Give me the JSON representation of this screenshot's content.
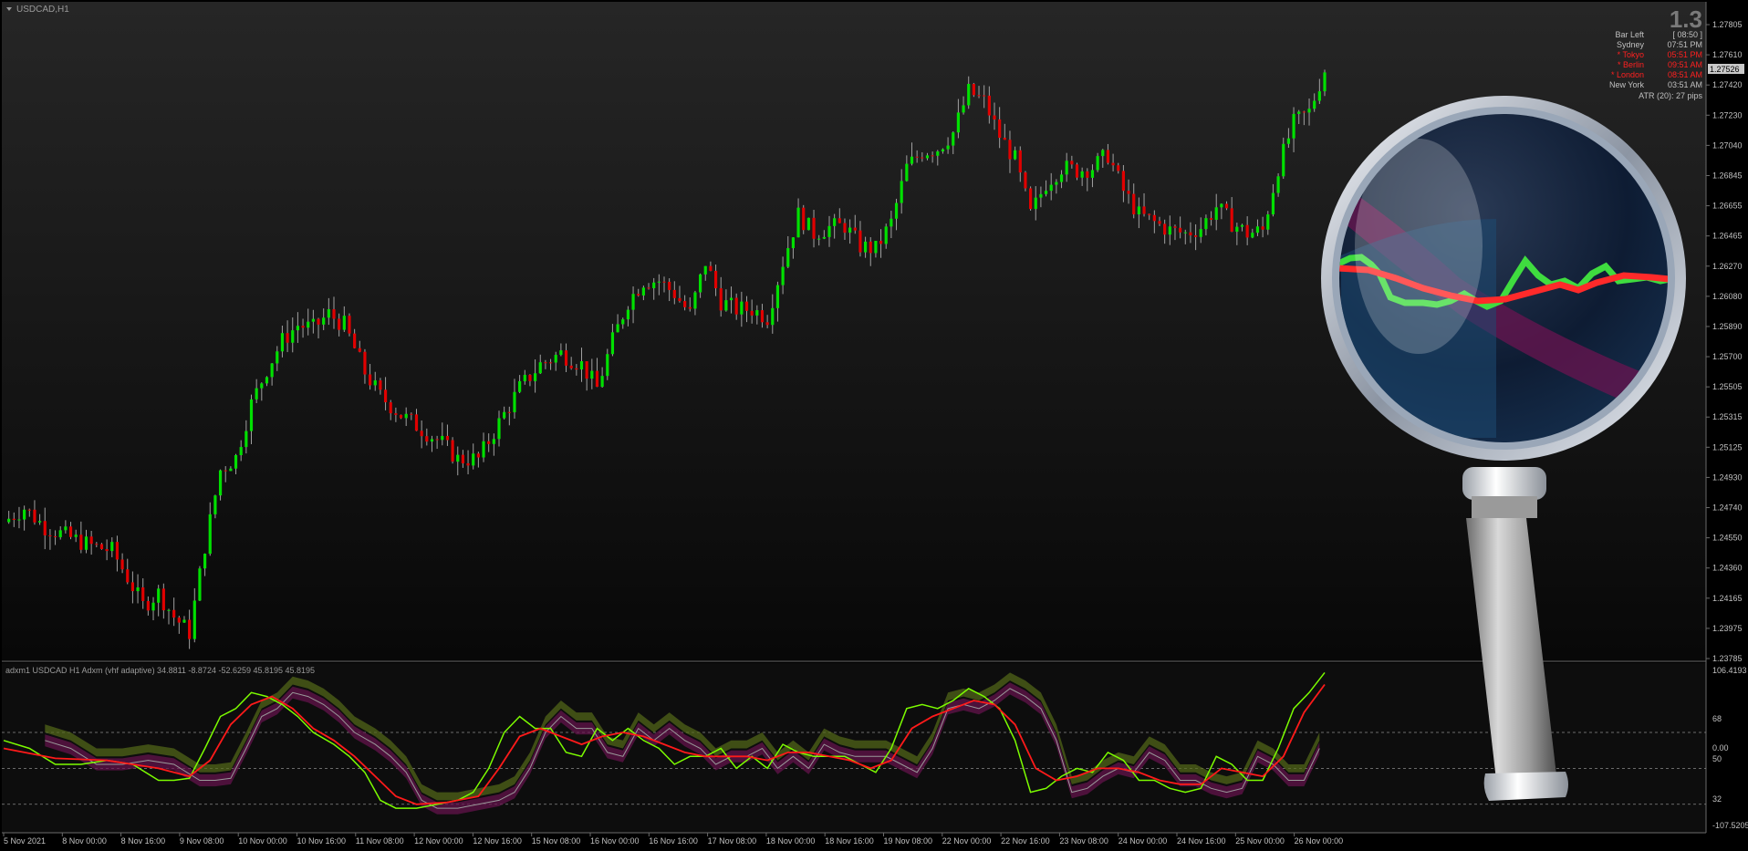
{
  "window": {
    "title": "USDCAD,H1",
    "menu_icon": "triangle-down-icon"
  },
  "info_panel": {
    "big_value": "1.3",
    "rows": [
      {
        "label": "Bar Left",
        "value": "[ 08:50 ]",
        "color": "#c0c0c0"
      },
      {
        "label": "Sydney",
        "value": "07:51 PM",
        "color": "#c0c0c0"
      },
      {
        "label": "* Tokyo",
        "value": "05:51 PM",
        "color": "#ff2020"
      },
      {
        "label": "* Berlin",
        "value": "09:51 AM",
        "color": "#ff2020"
      },
      {
        "label": "* London",
        "value": "08:51 AM",
        "color": "#ff2020"
      },
      {
        "label": "New York",
        "value": "03:51 AM",
        "color": "#c0c0c0"
      }
    ],
    "atr": "ATR (20): 27 pips"
  },
  "price_axis": {
    "ticks": [
      "1.27805",
      "1.27610",
      "1.27420",
      "1.27230",
      "1.27040",
      "1.26845",
      "1.26655",
      "1.26465",
      "1.26270",
      "1.26080",
      "1.25890",
      "1.25700",
      "1.25505",
      "1.25315",
      "1.25125",
      "1.24930",
      "1.24740",
      "1.24550",
      "1.24360",
      "1.24165",
      "1.23975",
      "1.23785"
    ],
    "current_price": "1.27526",
    "range": [
      1.23785,
      1.27805
    ]
  },
  "indicator": {
    "label": "adxm1 USDCAD H1 Adxm (vhf adaptive) 34.8811 -8.8724 -52.6259 45.8195 45.8195",
    "axis_ticks": [
      "106.4193",
      "68",
      "0.00",
      "50",
      "32",
      "-107.5205"
    ],
    "levels": [
      68,
      50,
      32
    ]
  },
  "time_axis": {
    "labels": [
      "5 Nov 2021",
      "8 Nov 00:00",
      "8 Nov 16:00",
      "9 Nov 08:00",
      "10 Nov 00:00",
      "10 Nov 16:00",
      "11 Nov 08:00",
      "12 Nov 00:00",
      "12 Nov 16:00",
      "15 Nov 08:00",
      "16 Nov 00:00",
      "16 Nov 16:00",
      "17 Nov 08:00",
      "18 Nov 00:00",
      "18 Nov 16:00",
      "19 Nov 08:00",
      "22 Nov 00:00",
      "22 Nov 16:00",
      "23 Nov 08:00",
      "24 Nov 00:00",
      "24 Nov 16:00",
      "25 Nov 00:00",
      "26 Nov 00:00"
    ]
  },
  "colors": {
    "bull": "#00e000",
    "bear": "#e00000",
    "background_top": "#262626",
    "background_bottom": "#080808",
    "axis_text": "#c0c0c0",
    "indicator_green": "#7cfc00",
    "indicator_red": "#ff1a1a",
    "indicator_white": "#9a9a9a",
    "cloud_olive": "#556b1a",
    "cloud_purple": "#6a1450"
  },
  "overlay_icon": "magnifying-glass-icon",
  "chart_data": {
    "type": "candlestick",
    "symbol": "USDCAD",
    "timeframe": "H1",
    "ylim": [
      1.23785,
      1.27805
    ],
    "close_path": [
      [
        0,
        1.2465
      ],
      [
        4,
        1.2474
      ],
      [
        8,
        1.2462
      ],
      [
        13,
        1.2455
      ],
      [
        17,
        1.245
      ],
      [
        21,
        1.2447
      ],
      [
        24,
        1.243
      ],
      [
        27,
        1.2412
      ],
      [
        30,
        1.242
      ],
      [
        33,
        1.2405
      ],
      [
        36,
        1.2395
      ],
      [
        39,
        1.245
      ],
      [
        42,
        1.2498
      ],
      [
        45,
        1.2506
      ],
      [
        48,
        1.254
      ],
      [
        51,
        1.2562
      ],
      [
        54,
        1.258
      ],
      [
        57,
        1.259
      ],
      [
        60,
        1.2588
      ],
      [
        63,
        1.2597
      ],
      [
        66,
        1.259
      ],
      [
        70,
        1.256
      ],
      [
        73,
        1.2545
      ],
      [
        77,
        1.2533
      ],
      [
        81,
        1.2524
      ],
      [
        85,
        1.2515
      ],
      [
        88,
        1.2505
      ],
      [
        92,
        1.2505
      ],
      [
        96,
        1.2528
      ],
      [
        100,
        1.255
      ],
      [
        104,
        1.2565
      ],
      [
        108,
        1.2572
      ],
      [
        112,
        1.2565
      ],
      [
        115,
        1.255
      ],
      [
        118,
        1.258
      ],
      [
        121,
        1.2605
      ],
      [
        124,
        1.2618
      ],
      [
        127,
        1.2618
      ],
      [
        130,
        1.261
      ],
      [
        133,
        1.2597
      ],
      [
        136,
        1.263
      ],
      [
        139,
        1.2605
      ],
      [
        142,
        1.26
      ],
      [
        145,
        1.26
      ],
      [
        148,
        1.2595
      ],
      [
        151,
        1.263
      ],
      [
        154,
        1.266
      ],
      [
        157,
        1.2648
      ],
      [
        160,
        1.2652
      ],
      [
        163,
        1.2653
      ],
      [
        166,
        1.264
      ],
      [
        169,
        1.2638
      ],
      [
        172,
        1.2655
      ],
      [
        175,
        1.269
      ],
      [
        178,
        1.27
      ],
      [
        181,
        1.2702
      ],
      [
        184,
        1.2712
      ],
      [
        187,
        1.2738
      ],
      [
        190,
        1.2732
      ],
      [
        193,
        1.271
      ],
      [
        196,
        1.2695
      ],
      [
        199,
        1.266
      ],
      [
        202,
        1.268
      ],
      [
        205,
        1.269
      ],
      [
        208,
        1.2688
      ],
      [
        211,
        1.269
      ],
      [
        214,
        1.2698
      ],
      [
        217,
        1.2675
      ],
      [
        220,
        1.266
      ],
      [
        223,
        1.2655
      ],
      [
        226,
        1.265
      ],
      [
        229,
        1.2648
      ],
      [
        232,
        1.2652
      ],
      [
        235,
        1.2665
      ],
      [
        238,
        1.2655
      ],
      [
        241,
        1.2648
      ],
      [
        244,
        1.265
      ],
      [
        247,
        1.269
      ],
      [
        250,
        1.2718
      ],
      [
        253,
        1.2725
      ],
      [
        256,
        1.2752
      ]
    ],
    "indicator_series": [
      {
        "color": "green",
        "points": [
          [
            0,
            64
          ],
          [
            5,
            60
          ],
          [
            10,
            52
          ],
          [
            15,
            52
          ],
          [
            20,
            54
          ],
          [
            25,
            52
          ],
          [
            30,
            44
          ],
          [
            33,
            44
          ],
          [
            36,
            45
          ],
          [
            39,
            60
          ],
          [
            42,
            76
          ],
          [
            45,
            80
          ],
          [
            48,
            88
          ],
          [
            51,
            86
          ],
          [
            54,
            82
          ],
          [
            57,
            76
          ],
          [
            60,
            68
          ],
          [
            64,
            62
          ],
          [
            67,
            56
          ],
          [
            70,
            48
          ],
          [
            73,
            34
          ],
          [
            76,
            30
          ],
          [
            80,
            30
          ],
          [
            84,
            32
          ],
          [
            88,
            34
          ],
          [
            91,
            38
          ],
          [
            94,
            50
          ],
          [
            97,
            68
          ],
          [
            100,
            76
          ],
          [
            103,
            70
          ],
          [
            106,
            70
          ],
          [
            109,
            58
          ],
          [
            112,
            56
          ],
          [
            115,
            70
          ],
          [
            118,
            64
          ],
          [
            121,
            70
          ],
          [
            124,
            64
          ],
          [
            127,
            60
          ],
          [
            130,
            52
          ],
          [
            133,
            56
          ],
          [
            136,
            56
          ],
          [
            139,
            60
          ],
          [
            142,
            50
          ],
          [
            145,
            56
          ],
          [
            148,
            50
          ],
          [
            151,
            62
          ],
          [
            154,
            58
          ],
          [
            157,
            56
          ],
          [
            160,
            56
          ],
          [
            163,
            56
          ],
          [
            166,
            52
          ],
          [
            169,
            48
          ],
          [
            172,
            60
          ],
          [
            175,
            80
          ],
          [
            178,
            82
          ],
          [
            181,
            80
          ],
          [
            184,
            84
          ],
          [
            187,
            90
          ],
          [
            190,
            86
          ],
          [
            193,
            80
          ],
          [
            196,
            64
          ],
          [
            199,
            38
          ],
          [
            202,
            40
          ],
          [
            205,
            46
          ],
          [
            208,
            50
          ],
          [
            211,
            48
          ],
          [
            214,
            58
          ],
          [
            217,
            54
          ],
          [
            220,
            44
          ],
          [
            223,
            44
          ],
          [
            226,
            40
          ],
          [
            229,
            38
          ],
          [
            232,
            40
          ],
          [
            235,
            56
          ],
          [
            238,
            52
          ],
          [
            241,
            44
          ],
          [
            244,
            44
          ],
          [
            247,
            60
          ],
          [
            250,
            80
          ],
          [
            253,
            88
          ],
          [
            256,
            98
          ]
        ]
      },
      {
        "color": "red",
        "points": [
          [
            0,
            60
          ],
          [
            10,
            55
          ],
          [
            20,
            54
          ],
          [
            30,
            50
          ],
          [
            36,
            46
          ],
          [
            40,
            54
          ],
          [
            44,
            72
          ],
          [
            48,
            82
          ],
          [
            52,
            86
          ],
          [
            56,
            80
          ],
          [
            60,
            70
          ],
          [
            64,
            64
          ],
          [
            68,
            56
          ],
          [
            72,
            46
          ],
          [
            76,
            36
          ],
          [
            80,
            32
          ],
          [
            86,
            33
          ],
          [
            92,
            36
          ],
          [
            96,
            50
          ],
          [
            100,
            66
          ],
          [
            104,
            70
          ],
          [
            108,
            66
          ],
          [
            112,
            62
          ],
          [
            116,
            66
          ],
          [
            120,
            68
          ],
          [
            124,
            66
          ],
          [
            128,
            62
          ],
          [
            132,
            58
          ],
          [
            136,
            56
          ],
          [
            140,
            56
          ],
          [
            144,
            56
          ],
          [
            148,
            54
          ],
          [
            152,
            58
          ],
          [
            156,
            58
          ],
          [
            160,
            56
          ],
          [
            164,
            54
          ],
          [
            168,
            50
          ],
          [
            172,
            54
          ],
          [
            176,
            70
          ],
          [
            180,
            76
          ],
          [
            184,
            80
          ],
          [
            188,
            84
          ],
          [
            192,
            82
          ],
          [
            196,
            72
          ],
          [
            200,
            50
          ],
          [
            204,
            44
          ],
          [
            208,
            46
          ],
          [
            212,
            50
          ],
          [
            216,
            50
          ],
          [
            220,
            48
          ],
          [
            224,
            44
          ],
          [
            228,
            42
          ],
          [
            232,
            42
          ],
          [
            236,
            50
          ],
          [
            240,
            48
          ],
          [
            244,
            46
          ],
          [
            248,
            56
          ],
          [
            252,
            78
          ],
          [
            256,
            92
          ]
        ]
      }
    ]
  }
}
